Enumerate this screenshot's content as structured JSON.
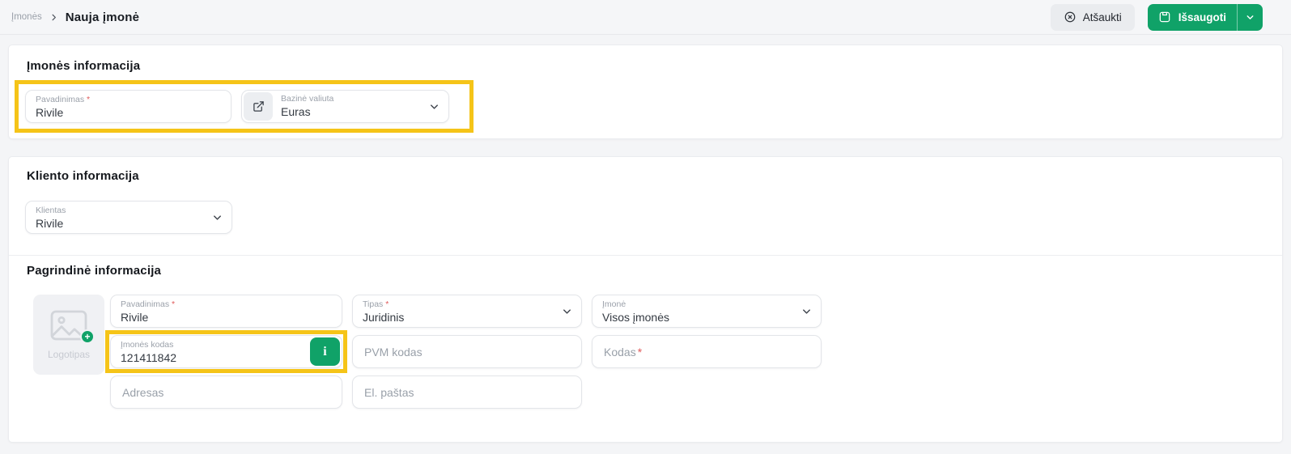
{
  "breadcrumb": {
    "parent": "Įmonės",
    "current": "Nauja įmonė"
  },
  "required_mark": "*",
  "topbar": {
    "cancel_label": "Atšaukti",
    "save_label": "Išsaugoti"
  },
  "company_section": {
    "title": "Įmonės informacija",
    "name_field": {
      "label": "Pavadinimas",
      "value": "Rivile"
    },
    "currency_field": {
      "label": "Bazinė valiuta",
      "value": "Euras"
    }
  },
  "client_section": {
    "title": "Kliento informacija",
    "client_field": {
      "label": "Klientas",
      "value": "Rivile"
    }
  },
  "main_section": {
    "title": "Pagrindinė informacija",
    "logo_label": "Logotipas",
    "logo_add_glyph": "+",
    "name_field": {
      "label": "Pavadinimas",
      "value": "Rivile"
    },
    "type_field": {
      "label": "Tipas",
      "value": "Juridinis"
    },
    "company_field": {
      "label": "Įmonė",
      "value": "Visos įmonės"
    },
    "company_code_field": {
      "label": "Įmonės kodas",
      "value": "121411842",
      "info_glyph": "i"
    },
    "vat_field": {
      "placeholder": "PVM kodas"
    },
    "code_field": {
      "placeholder": "Kodas"
    },
    "address_field": {
      "placeholder": "Adresas"
    },
    "email_field": {
      "placeholder": "El. paštas"
    }
  },
  "icons": {
    "cancel": "x-circle-icon",
    "save": "floppy-disk-icon",
    "save_menu": "chevron-down-icon",
    "breadcrumb_sep": "chevron-right-icon",
    "currency_link": "external-link-icon",
    "logo": "image-placeholder-icon",
    "logo_add": "plus-icon",
    "company_code_info": "info-icon"
  },
  "colors": {
    "accent_green": "#10a268",
    "highlight_yellow": "#f5c418",
    "required_red": "#e05a5a",
    "cancel_button_gray": "#eaecef"
  }
}
